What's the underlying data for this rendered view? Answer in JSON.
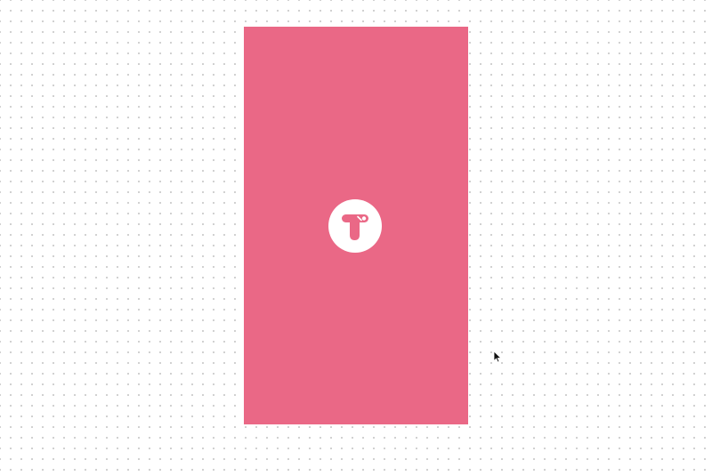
{
  "canvas": {
    "background": "#ffffff",
    "dot_color": "#c4c4c4"
  },
  "frame": {
    "fill": "#ea6886"
  },
  "logo": {
    "icon": "app-logo-icon",
    "circle_color": "#ffffff",
    "glyph_color": "#ea6886"
  },
  "cursor": {
    "icon": "mouse-pointer-icon"
  }
}
